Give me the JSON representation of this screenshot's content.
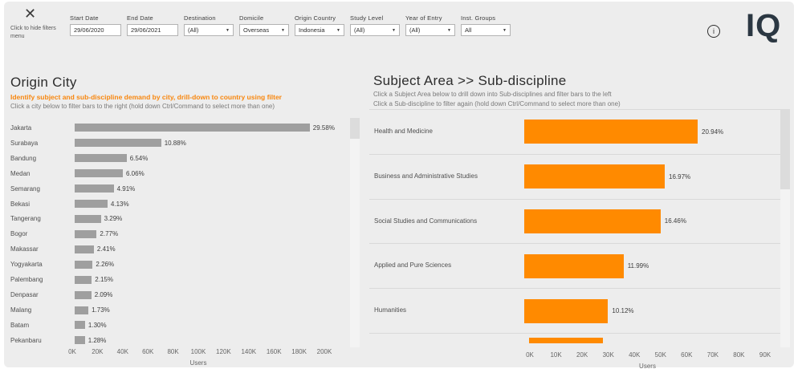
{
  "icons": {
    "close": "✕",
    "info": "i",
    "dropdown": "▼"
  },
  "header": {
    "hide_filters_text": "Click to hide filters menu",
    "logo": "IQ",
    "filters": [
      {
        "label": "Start Date",
        "type": "input",
        "value": "29/06/2020"
      },
      {
        "label": "End Date",
        "type": "input",
        "value": "29/06/2021"
      },
      {
        "label": "Destination",
        "type": "select",
        "value": "(All)"
      },
      {
        "label": "Domicile",
        "type": "select",
        "value": "Overseas"
      },
      {
        "label": "Origin Country",
        "type": "select",
        "value": "Indonesia"
      },
      {
        "label": "Study Level",
        "type": "select",
        "value": "(All)"
      },
      {
        "label": "Year of Entry",
        "type": "select",
        "value": "(All)"
      },
      {
        "label": "Inst. Groups",
        "type": "select",
        "value": "All"
      }
    ]
  },
  "chart_data": [
    {
      "type": "bar",
      "orientation": "horizontal",
      "title": "Origin City",
      "subtitle": "Identify subject and sub-discipline demand by city, drill-down to country using filter",
      "instruction": "Click a city below to filter bars to the right (hold down Ctrl/Command to select more than one)",
      "categories": [
        "Jakarta",
        "Surabaya",
        "Bandung",
        "Medan",
        "Semarang",
        "Bekasi",
        "Tangerang",
        "Bogor",
        "Makassar",
        "Yogyakarta",
        "Palembang",
        "Denpasar",
        "Malang",
        "Batam",
        "Pekanbaru"
      ],
      "values_pct": [
        29.58,
        10.88,
        6.54,
        6.06,
        4.91,
        4.13,
        3.29,
        2.77,
        2.41,
        2.26,
        2.15,
        2.09,
        1.73,
        1.3,
        1.28
      ],
      "value_labels": [
        "29.58%",
        "10.88%",
        "6.54%",
        "6.06%",
        "4.91%",
        "4.13%",
        "3.29%",
        "2.77%",
        "2.41%",
        "2.26%",
        "2.15%",
        "2.09%",
        "1.73%",
        "1.30%",
        "1.28%"
      ],
      "xlabel": "Users",
      "x_ticks": [
        "0K",
        "20K",
        "40K",
        "60K",
        "80K",
        "100K",
        "120K",
        "140K",
        "160K",
        "180K",
        "200K"
      ],
      "xlim_users": [
        0,
        200000
      ],
      "bar_color": "#9f9f9f",
      "legend": "none",
      "grid": "off"
    },
    {
      "type": "bar",
      "orientation": "horizontal",
      "title": "Subject Area >> Sub-discipline",
      "instructions": [
        "Click a Subject Area below to drill down into Sub-disciplines and filter bars to the left",
        "Click a Sub-discipline to filter again (hold down Ctrl/Command to select more than one)"
      ],
      "categories": [
        "Health and Medicine",
        "Business and Administrative Studies",
        "Social Studies and Communications",
        "Applied and Pure Sciences",
        "Humanities"
      ],
      "values_pct": [
        20.94,
        16.97,
        16.46,
        11.99,
        10.12
      ],
      "value_labels": [
        "20.94%",
        "16.97%",
        "16.46%",
        "11.99%",
        "10.12%"
      ],
      "next_bar_partial": {
        "visible": true,
        "approx_pct": 8.9
      },
      "xlabel": "Users",
      "x_ticks": [
        "0K",
        "10K",
        "20K",
        "30K",
        "40K",
        "50K",
        "60K",
        "70K",
        "80K",
        "90K"
      ],
      "xlim_users": [
        0,
        90000
      ],
      "bar_color": "#ff8a00",
      "legend": "none",
      "grid": "off"
    }
  ]
}
